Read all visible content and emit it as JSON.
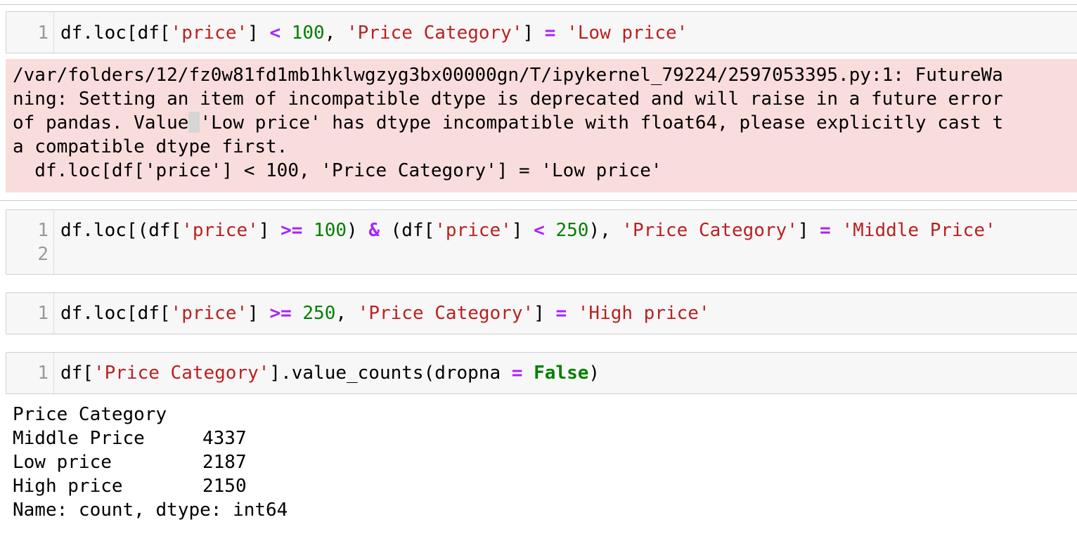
{
  "cell1": {
    "line_number": "1",
    "t1": "df.loc[df[",
    "s1": "'price'",
    "t2": "] ",
    "op1": "<",
    "t3": " ",
    "n1": "100",
    "t4": ", ",
    "s2": "'Price Category'",
    "t5": "] ",
    "op2": "=",
    "t6": " ",
    "s3": "'Low price'"
  },
  "warning": {
    "line1": "/var/folders/12/fz0w81fd1mb1hklwgzyg3bx00000gn/T/ipykernel_79224/2597053395.py:1: FutureWa",
    "line2": "ning: Setting an item of incompatible dtype is deprecated and will raise in a future error",
    "line3_a": "of pandas. Value",
    "line3_b": "'Low price' has dtype incompatible with float64, please explicitly cast t",
    "line4": "a compatible dtype first.",
    "line5": "  df.loc[df['price'] < 100, 'Price Category'] = 'Low price'"
  },
  "cell2": {
    "line_number_1": "1",
    "line_number_2": "2",
    "t1": "df.loc[(df[",
    "s1": "'price'",
    "t2": "] ",
    "op1": ">=",
    "t3": " ",
    "n1": "100",
    "t4": ") ",
    "op2": "&",
    "t5": " (df[",
    "s2": "'price'",
    "t6": "] ",
    "op3": "<",
    "t7": " ",
    "n2": "250",
    "t8": "), ",
    "s3": "'Price Category'",
    "t9": "] ",
    "op4": "=",
    "t10": " ",
    "s4": "'Middle Price'"
  },
  "cell3": {
    "line_number": "1",
    "t1": "df.loc[df[",
    "s1": "'price'",
    "t2": "] ",
    "op1": ">=",
    "t3": " ",
    "n1": "250",
    "t4": ", ",
    "s2": "'Price Category'",
    "t5": "] ",
    "op2": "=",
    "t6": " ",
    "s3": "'High price'"
  },
  "cell4": {
    "line_number": "1",
    "t1": "df[",
    "s1": "'Price Category'",
    "t2": "].value_counts(dropna ",
    "op1": "=",
    "t3": " ",
    "kw1": "False",
    "t4": ")"
  },
  "output": {
    "header": "Price Category",
    "rows": [
      {
        "label": "Middle Price",
        "value": "4337"
      },
      {
        "label": "Low price",
        "value": "2187"
      },
      {
        "label": "High price",
        "value": "2150"
      }
    ],
    "footer": "Name: count, dtype: int64"
  },
  "colors": {
    "string": "#ba2121",
    "number": "#008000",
    "operator": "#aa22ff",
    "keyword": "#008000",
    "stderr_bg": "#f9dddd",
    "cell_bg": "#f7f7f7"
  }
}
